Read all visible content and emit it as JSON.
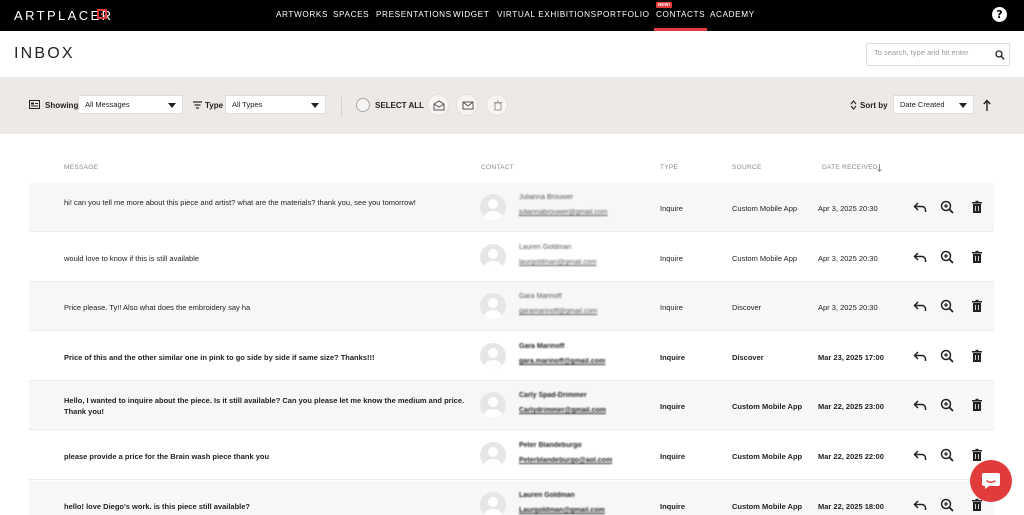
{
  "brand": {
    "logo_text": "ARTPLACER"
  },
  "nav": {
    "items": [
      {
        "label": "ARTWORKS"
      },
      {
        "label": "SPACES"
      },
      {
        "label": "PRESENTATIONS"
      },
      {
        "label": "WIDGET"
      },
      {
        "label": "VIRTUAL EXHIBITIONS"
      },
      {
        "label": "PORTFOLIO"
      },
      {
        "label": "CONTACTS",
        "active": true
      },
      {
        "label": "ACADEMY"
      }
    ],
    "new_badge": "NEW!",
    "help_label": "?"
  },
  "header": {
    "title": "INBOX",
    "search_placeholder": "To search, type and hit enter"
  },
  "filters": {
    "showing_label": "Showing",
    "showing_value": "All Messages",
    "type_label": "Type",
    "type_value": "All Types",
    "select_all_label": "SELECT ALL",
    "sort_label": "Sort by",
    "sort_value": "Date Created"
  },
  "table": {
    "columns": {
      "message": "MESSAGE",
      "contact": "CONTACT",
      "type": "TYPE",
      "source": "SOURCE",
      "date": "DATE RECEIVED"
    },
    "rows": [
      {
        "message": "hi! can you tell me more about this piece and artist? what are the materials? thank you, see you tomorrow!",
        "name": "Julianna Brouwer",
        "email": "juliannabrouwer@gmail.com",
        "type": "Inquire",
        "source": "Custom Mobile App",
        "date": "Apr 3, 2025 20:30",
        "unread": false
      },
      {
        "message": "would love to know if this is still available",
        "name": "Lauren Goldman",
        "email": "laurgoldman@gmail.com",
        "type": "Inquire",
        "source": "Custom Mobile App",
        "date": "Apr 3, 2025 20:30",
        "unread": false
      },
      {
        "message": "Price please. Ty!! Also what does the embroidery say ha",
        "name": "Gara Marinoff",
        "email": "garamarinoff@gmail.com",
        "type": "Inquire",
        "source": "Discover",
        "date": "Apr 3, 2025 20:30",
        "unread": false
      },
      {
        "message": "Price of this and the other similar one in pink to go side by side if same size? Thanks!!!",
        "name": "Gara Marinoff",
        "email": "gara.marinoff@gmail.com",
        "type": "Inquire",
        "source": "Discover",
        "date": "Mar 23, 2025 17:00",
        "unread": true
      },
      {
        "message": "Hello, I wanted to inquire about the piece. Is it still available? Can you please let me know the medium and price. Thank you!",
        "name": "Carly Spad-Drimmer",
        "email": "Carlydrimmer@gmail.com",
        "type": "Inquire",
        "source": "Custom Mobile App",
        "date": "Mar 22, 2025 23:00",
        "unread": true
      },
      {
        "message": "please provide a price for the Brain wash piece thank you",
        "name": "Peter Blandeburgo",
        "email": "Peterblandeburgo@aol.com",
        "type": "Inquire",
        "source": "Custom Mobile App",
        "date": "Mar 22, 2025 22:00",
        "unread": true
      },
      {
        "message": "hello! love Diego's work. is this piece still available?",
        "name": "Lauren Goldman",
        "email": "Laurgoldman@gmail.com",
        "type": "Inquire",
        "source": "Custom Mobile App",
        "date": "Mar 22, 2025 18:00",
        "unread": true
      }
    ]
  }
}
